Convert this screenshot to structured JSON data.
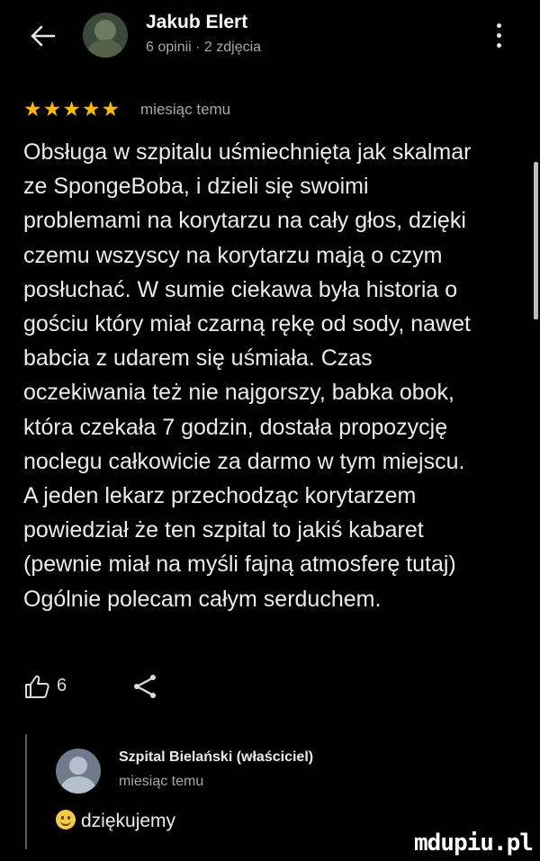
{
  "header": {
    "name": "Jakub Elert",
    "meta": "6 opinii · 2 zdjęcia",
    "back_icon": "arrow-left-icon",
    "menu_icon": "more-vert-icon"
  },
  "rating": {
    "stars": 5,
    "stars_text": "★★★★★",
    "time": "miesiąc temu",
    "star_color": "#fbbc04"
  },
  "review": {
    "lines": [
      "Obsługa w szpitalu uśmiechnięta jak skalmar",
      "ze SpongeBoba, i dzieli się swoimi",
      "problemami na korytarzu na cały głos, dzięki",
      "czemu wszyscy na korytarzu mają o czym",
      "posłuchać. W sumie ciekawa była historia o",
      "gościu który miał czarną rękę od sody, nawet",
      "babcia z udarem się uśmiała. Czas",
      "oczekiwania też nie najgorszy, babka obok,",
      "która czekała 7 godzin, dostała propozycję",
      "noclegu całkowicie za darmo w tym miejscu.",
      "A jeden lekarz przechodząc korytarzem",
      "powiedział że ten szpital to jakiś kabaret",
      "(pewnie miał na myśli fajną atmosferę tutaj)",
      "Ogólnie polecam całym serduchem."
    ]
  },
  "actions": {
    "like_count": "6",
    "like_icon": "thumb-up-icon",
    "share_icon": "share-icon"
  },
  "owner_reply": {
    "name": "Szpital Bielański (właściciel)",
    "time": "miesiąc temu",
    "text": "dziękujemy",
    "emoji_icon": "smiley-icon"
  },
  "watermark": {
    "text": "mdupiu.pl"
  }
}
